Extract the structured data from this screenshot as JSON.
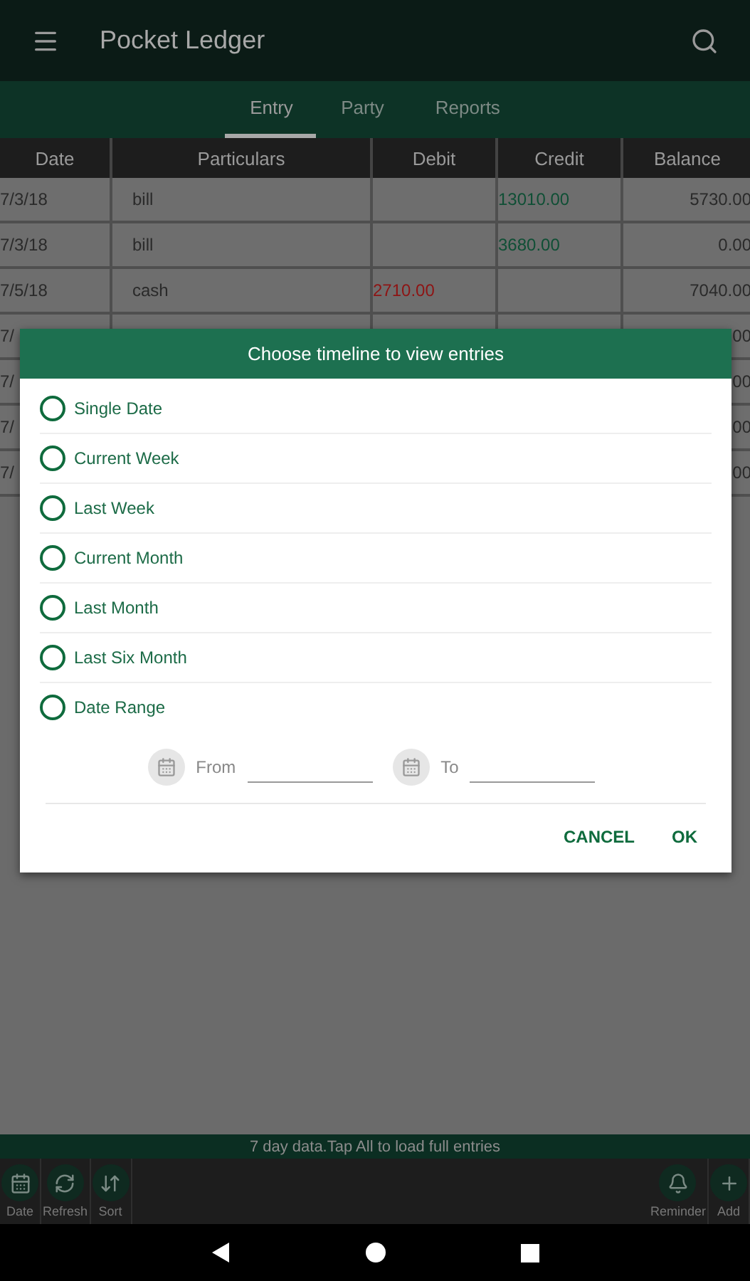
{
  "app_bar": {
    "title": "Pocket Ledger"
  },
  "tabs": [
    {
      "label": "Entry",
      "selected": true
    },
    {
      "label": "Party",
      "selected": false
    },
    {
      "label": "Reports",
      "selected": false
    }
  ],
  "table": {
    "columns": [
      "Date",
      "Particulars",
      "Debit",
      "Credit",
      "Balance"
    ],
    "rows": [
      {
        "date": "7/3/18",
        "particulars": "bill",
        "debit": "",
        "credit": "13010.00",
        "balance": "5730.00"
      },
      {
        "date": "7/3/18",
        "particulars": "bill",
        "debit": "",
        "credit": "3680.00",
        "balance": "0.00"
      },
      {
        "date": "7/5/18",
        "particulars": "cash",
        "debit": "2710.00",
        "credit": "",
        "balance": "7040.00"
      },
      {
        "date": "7/",
        "particulars": "",
        "debit": "",
        "credit": "",
        "balance": "00"
      },
      {
        "date": "7/",
        "particulars": "",
        "debit": "",
        "credit": "",
        "balance": "00"
      },
      {
        "date": "7/",
        "particulars": "",
        "debit": "",
        "credit": "",
        "balance": "00"
      },
      {
        "date": "7/",
        "particulars": "",
        "debit": "",
        "credit": "",
        "balance": "00"
      }
    ]
  },
  "dialog": {
    "title": "Choose timeline to view entries",
    "options": [
      {
        "label": "Single Date",
        "selected": false
      },
      {
        "label": "Current Week",
        "selected": false
      },
      {
        "label": "Last Week",
        "selected": false
      },
      {
        "label": "Current Month",
        "selected": false
      },
      {
        "label": "Last Month",
        "selected": false
      },
      {
        "label": "Last Six Month",
        "selected": false
      },
      {
        "label": "Date Range",
        "selected": false
      }
    ],
    "from_label": "From",
    "to_label": "To",
    "buttons": [
      "CANCEL",
      "OK"
    ]
  },
  "info_bar": "7 day data.Tap All to load full entries",
  "toolbar": [
    {
      "kind": "date",
      "label": "Date"
    },
    {
      "kind": "refresh",
      "label": "Refresh"
    },
    {
      "kind": "sort",
      "label": "Sort"
    },
    {
      "kind": "reminder",
      "label": "Reminder"
    },
    {
      "kind": "add",
      "label": "Add"
    }
  ]
}
